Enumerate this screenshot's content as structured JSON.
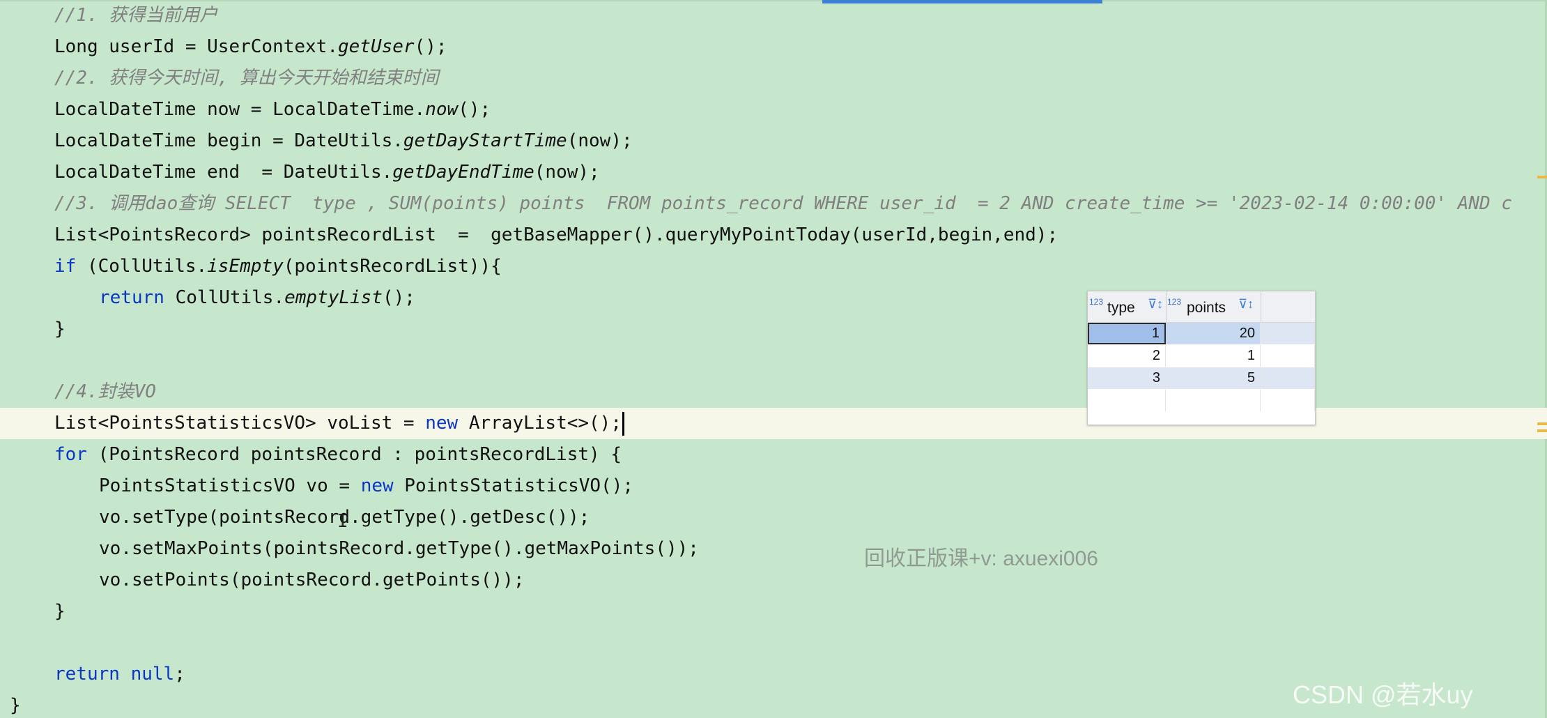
{
  "code": {
    "lines": [
      {
        "parts": [
          {
            "t": "//1. 获得当前用户",
            "c": "cmt"
          }
        ]
      },
      {
        "parts": [
          {
            "t": "Long userId = UserContext.",
            "c": ""
          },
          {
            "t": "getUser",
            "c": "fn"
          },
          {
            "t": "();",
            "c": ""
          }
        ]
      },
      {
        "parts": [
          {
            "t": "//2. 获得今天时间, 算出今天开始和结束时间",
            "c": "cmt"
          }
        ]
      },
      {
        "parts": [
          {
            "t": "LocalDateTime now = LocalDateTime.",
            "c": ""
          },
          {
            "t": "now",
            "c": "fn"
          },
          {
            "t": "();",
            "c": ""
          }
        ]
      },
      {
        "parts": [
          {
            "t": "LocalDateTime begin = DateUtils.",
            "c": ""
          },
          {
            "t": "getDayStartTime",
            "c": "fn"
          },
          {
            "t": "(now);",
            "c": ""
          }
        ]
      },
      {
        "parts": [
          {
            "t": "LocalDateTime end  = DateUtils.",
            "c": ""
          },
          {
            "t": "getDayEndTime",
            "c": "fn"
          },
          {
            "t": "(now);",
            "c": ""
          }
        ]
      },
      {
        "parts": [
          {
            "t": "//3. 调用dao查询 SELECT  type , SUM(points) points  FROM points_record WHERE user_id  = 2 AND create_time >= '2023-02-14 0:00:00' AND c",
            "c": "cmt"
          }
        ]
      },
      {
        "parts": [
          {
            "t": "List<PointsRecord> pointsRecordList  =  getBaseMapper().queryMyPointToday(userId,begin,end);",
            "c": ""
          }
        ]
      },
      {
        "parts": [
          {
            "t": "if",
            "c": "kw"
          },
          {
            "t": " (CollUtils.",
            "c": ""
          },
          {
            "t": "isEmpty",
            "c": "fn"
          },
          {
            "t": "(pointsRecordList)){",
            "c": ""
          }
        ]
      },
      {
        "parts": [
          {
            "t": "return",
            "c": "kw"
          },
          {
            "t": " CollUtils.",
            "c": ""
          },
          {
            "t": "emptyList",
            "c": "fn"
          },
          {
            "t": "();",
            "c": ""
          }
        ]
      },
      {
        "parts": [
          {
            "t": "}",
            "c": ""
          }
        ]
      },
      {
        "parts": []
      },
      {
        "parts": [
          {
            "t": "//4.封装VO",
            "c": "cmt"
          }
        ]
      },
      {
        "parts": [
          {
            "t": "List<PointsStatisticsVO> voList = ",
            "c": ""
          },
          {
            "t": "new",
            "c": "kw"
          },
          {
            "t": " ArrayList<>();",
            "c": ""
          }
        ]
      },
      {
        "parts": [
          {
            "t": "for",
            "c": "kw"
          },
          {
            "t": " (PointsRecord pointsRecord : pointsRecordList) {",
            "c": ""
          }
        ]
      },
      {
        "parts": [
          {
            "t": "PointsStatisticsVO vo = ",
            "c": ""
          },
          {
            "t": "new",
            "c": "kw"
          },
          {
            "t": " PointsStatisticsVO();",
            "c": ""
          }
        ]
      },
      {
        "parts": [
          {
            "t": "vo.setType(pointsRecord.getType().getDesc());",
            "c": ""
          }
        ]
      },
      {
        "parts": [
          {
            "t": "vo.setMaxPoints(pointsRecord.getType().getMaxPoints());",
            "c": ""
          }
        ]
      },
      {
        "parts": [
          {
            "t": "vo.setPoints(pointsRecord.getPoints());",
            "c": ""
          }
        ]
      },
      {
        "parts": [
          {
            "t": "}",
            "c": ""
          }
        ]
      },
      {
        "parts": []
      },
      {
        "parts": [
          {
            "t": "return",
            "c": "kw"
          },
          {
            "t": " ",
            "c": ""
          },
          {
            "t": "null",
            "c": "kw"
          },
          {
            "t": ";",
            "c": ""
          }
        ]
      },
      {
        "parts": [
          {
            "t": "}",
            "c": ""
          }
        ]
      }
    ]
  },
  "result_grid": {
    "columns": [
      {
        "type_badge": "123",
        "label": "type",
        "sort_icon": "filter-sort-icon"
      },
      {
        "type_badge": "123",
        "label": "points",
        "sort_icon": "filter-sort-icon"
      }
    ],
    "rows": [
      [
        "1",
        "20"
      ],
      [
        "2",
        "1"
      ],
      [
        "3",
        "5"
      ]
    ]
  },
  "watermark": "回收正版课+v: axuexi006",
  "csdn_mark": "CSDN @若水uy",
  "colors": {
    "editor_bg": "#c7e7cc",
    "current_line_bg": "#f6f7e9",
    "keyword": "#0b36c6",
    "comment": "#808080",
    "accent": "#3c7fd6"
  }
}
